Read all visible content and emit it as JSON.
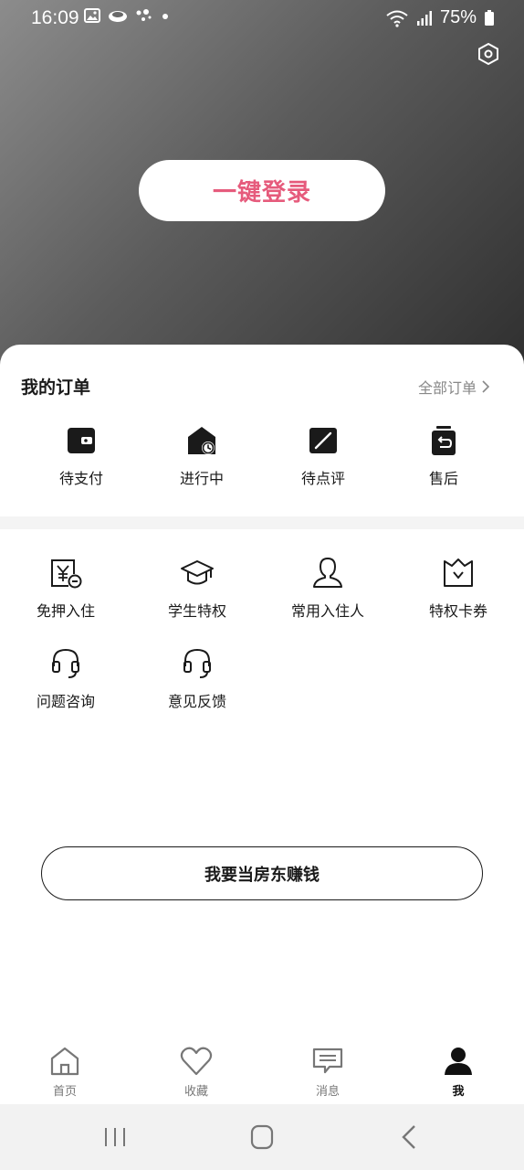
{
  "status": {
    "time": "16:09",
    "battery": "75%",
    "left_icons": [
      "gallery-icon",
      "cloud-icon",
      "assistant-icon",
      "dot-icon"
    ],
    "right_icons": [
      "wifi-icon",
      "signal-icon",
      "battery-icon"
    ]
  },
  "header": {
    "login_label": "一键登录",
    "accent_color": "#e65b7c"
  },
  "orders": {
    "title": "我的订单",
    "all_label": "全部订单",
    "items": [
      {
        "label": "待支付",
        "icon": "wallet-icon"
      },
      {
        "label": "进行中",
        "icon": "house-clock-icon"
      },
      {
        "label": "待点评",
        "icon": "edit-icon"
      },
      {
        "label": "售后",
        "icon": "return-icon"
      }
    ]
  },
  "services": {
    "items": [
      {
        "label": "免押入住",
        "icon": "deposit-free-icon"
      },
      {
        "label": "学生特权",
        "icon": "graduation-cap-icon"
      },
      {
        "label": "常用入住人",
        "icon": "person-icon"
      },
      {
        "label": "特权卡券",
        "icon": "crown-card-icon"
      },
      {
        "label": "问题咨询",
        "icon": "headset-icon"
      },
      {
        "label": "意见反馈",
        "icon": "headset-feedback-icon"
      }
    ]
  },
  "host": {
    "label": "我要当房东赚钱"
  },
  "tabbar": {
    "items": [
      {
        "label": "首页",
        "icon": "home-icon"
      },
      {
        "label": "收藏",
        "icon": "heart-icon"
      },
      {
        "label": "消息",
        "icon": "message-icon"
      },
      {
        "label": "我",
        "icon": "user-icon",
        "active": true
      }
    ]
  }
}
